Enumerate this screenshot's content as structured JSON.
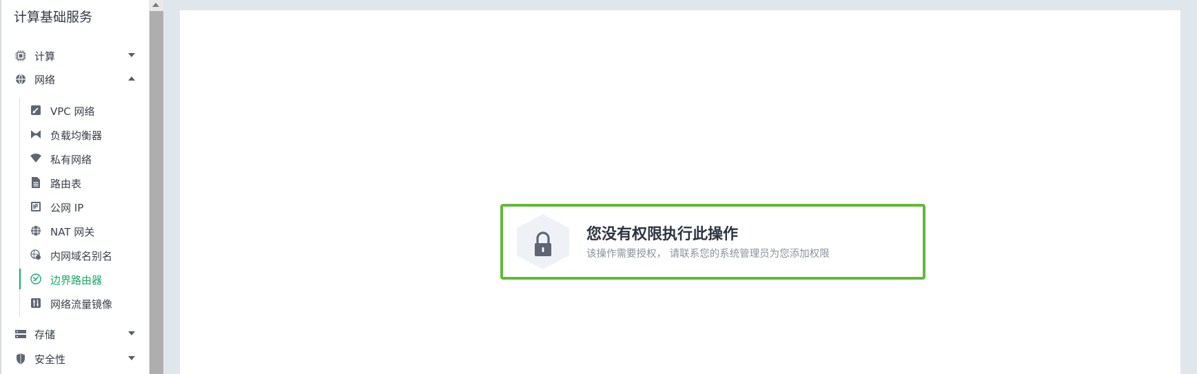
{
  "sidebar": {
    "title": "计算基础服务",
    "groups": [
      {
        "label": "计算",
        "icon": "chip-icon",
        "expanded": false
      },
      {
        "label": "网络",
        "icon": "globe-icon",
        "expanded": true
      },
      {
        "label": "存储",
        "icon": "storage-icon",
        "expanded": false
      },
      {
        "label": "安全性",
        "icon": "shield-icon",
        "expanded": false
      }
    ],
    "network_items": [
      {
        "label": "VPC 网络",
        "icon": "vpc-icon"
      },
      {
        "label": "负载均衡器",
        "icon": "load-balancer-icon"
      },
      {
        "label": "私有网络",
        "icon": "wifi-icon"
      },
      {
        "label": "路由表",
        "icon": "route-table-icon"
      },
      {
        "label": "公网 IP",
        "icon": "ip-icon"
      },
      {
        "label": "NAT 网关",
        "icon": "nat-gateway-icon"
      },
      {
        "label": "内网域名别名",
        "icon": "dns-alias-icon"
      },
      {
        "label": "边界路由器",
        "icon": "border-router-icon",
        "active": true
      },
      {
        "label": "网络流量镜像",
        "icon": "traffic-mirror-icon"
      }
    ]
  },
  "permission": {
    "title": "您没有权限执行此操作",
    "description": "该操作需要授权， 请联系您的系统管理员为您添加权限",
    "icon": "lock-icon"
  },
  "colors": {
    "accent": "#1aa86c",
    "highlight_border": "#5fba35",
    "main_bg": "#dfe6ec"
  }
}
